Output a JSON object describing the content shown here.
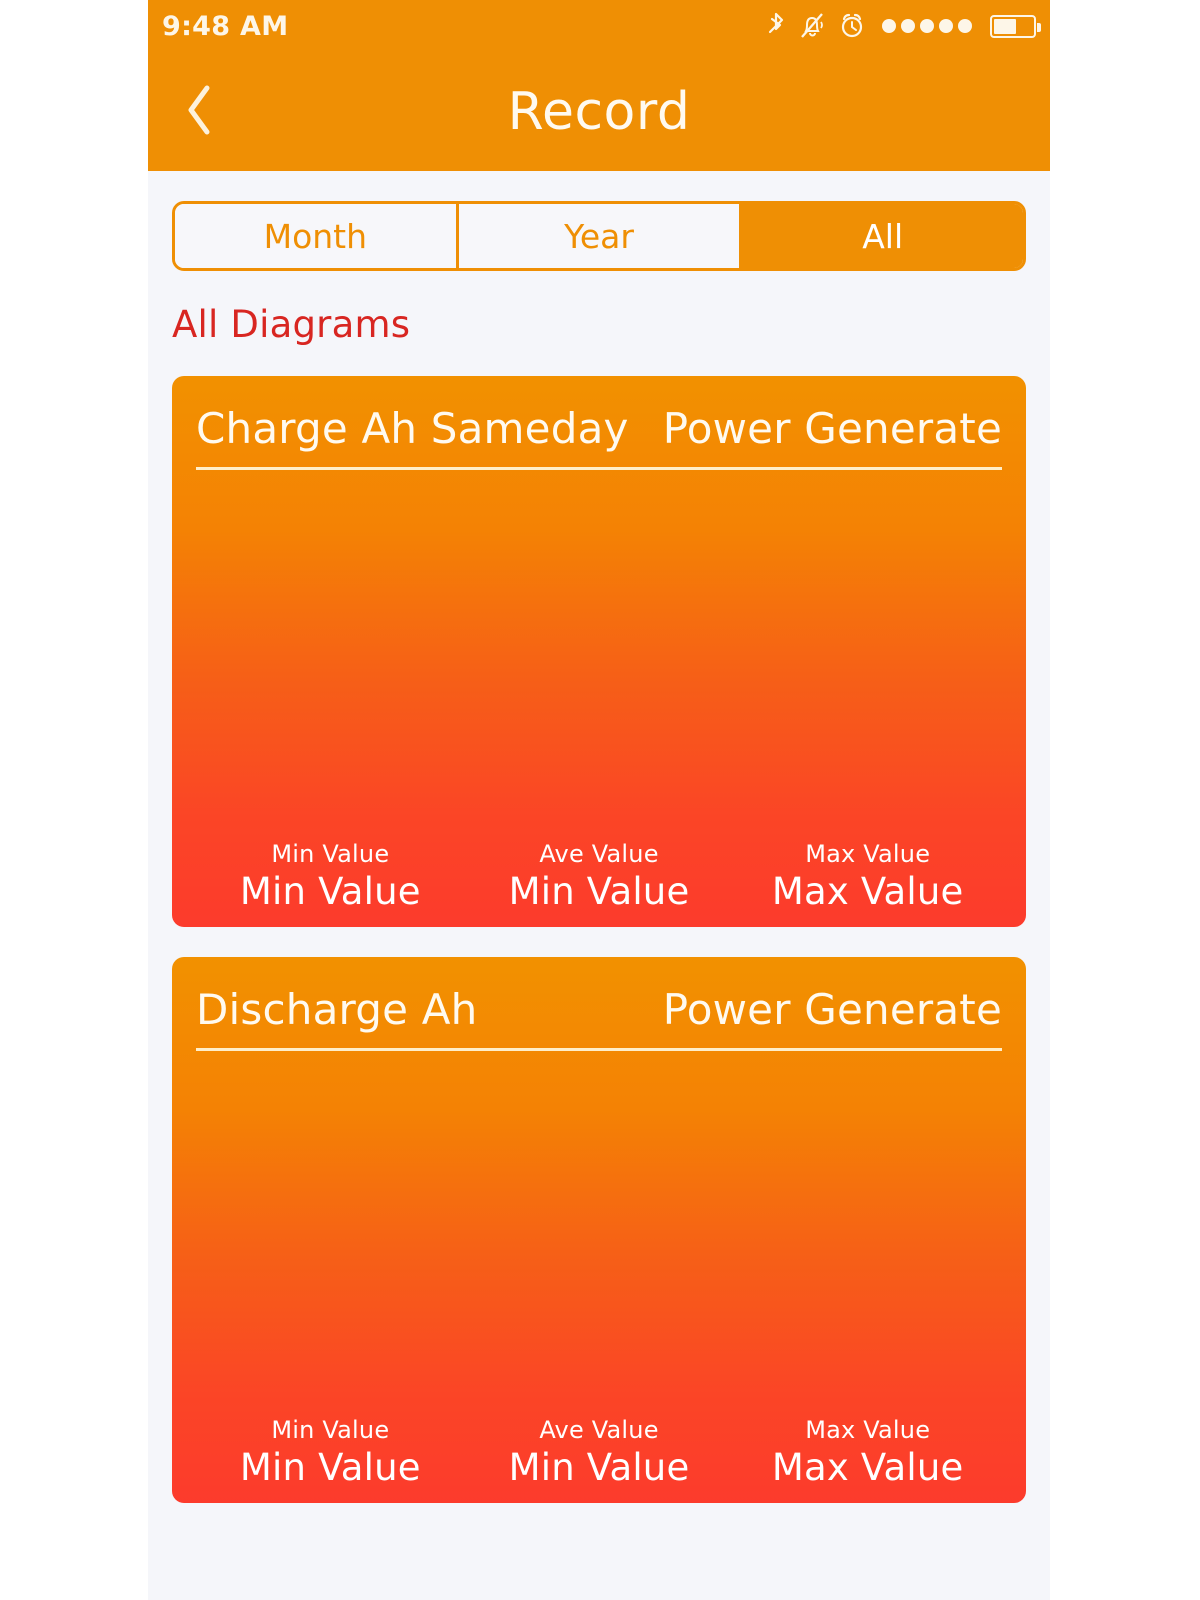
{
  "status_bar": {
    "time": "9:48 AM",
    "icons": [
      "bluetooth-icon",
      "silent-bell-icon",
      "alarm-clock-icon",
      "signal-dots-icon",
      "battery-icon"
    ],
    "signal_dots": 5,
    "battery_level": "52%"
  },
  "nav": {
    "back_icon": "chevron-left-icon",
    "title": "Record"
  },
  "segmented": {
    "options": [
      {
        "label": "Month",
        "selected": false
      },
      {
        "label": "Year",
        "selected": false
      },
      {
        "label": "All",
        "selected": true
      }
    ],
    "selected": "All"
  },
  "section": {
    "title": "All Diagrams"
  },
  "colors": {
    "accent_orange": "#ef8f04",
    "card_gradient_top": "#f29100",
    "card_gradient_bottom": "#fc3b2c",
    "section_title_red": "#d82621",
    "page_background": "#f5f6fa",
    "segment_fill": "#f7f7fa"
  },
  "cards": [
    {
      "head_left": "Charge Ah Sameday",
      "head_right": "Power Generate",
      "stats": [
        {
          "label": "Min Value",
          "value": "Min Value"
        },
        {
          "label": "Ave Value",
          "value": "Min Value"
        },
        {
          "label": "Max Value",
          "value": "Max Value"
        }
      ]
    },
    {
      "head_left": "Discharge Ah",
      "head_right": "Power Generate",
      "stats": [
        {
          "label": "Min Value",
          "value": "Min Value"
        },
        {
          "label": "Ave Value",
          "value": "Min Value"
        },
        {
          "label": "Max Value",
          "value": "Max Value"
        }
      ]
    }
  ]
}
